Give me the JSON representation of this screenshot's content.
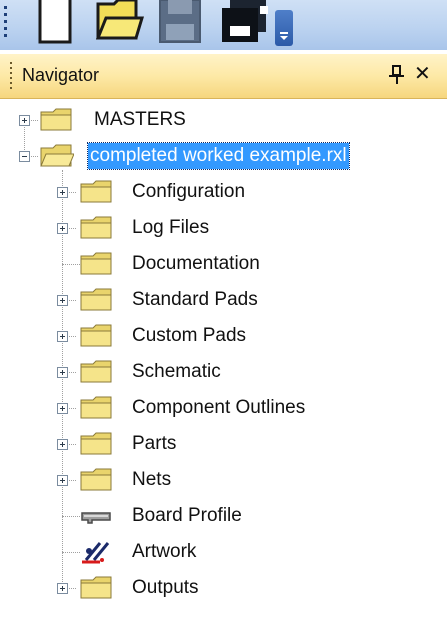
{
  "toolbar": {
    "buttons": [
      {
        "icon": "new-document-icon"
      },
      {
        "icon": "open-folder-icon"
      },
      {
        "icon": "save-disk-icon"
      },
      {
        "icon": "save-all-icon"
      }
    ],
    "overflow_icon": "toolbar-overflow-icon"
  },
  "navigator": {
    "title": "Navigator",
    "pin_icon": "pin-icon",
    "close_glyph": "✕",
    "tree": {
      "masters": "MASTERS",
      "project": "completed worked example.rxl",
      "children": [
        "Configuration",
        "Log Files",
        "Documentation",
        "Standard Pads",
        "Custom Pads",
        "Schematic",
        "Component Outlines",
        "Parts",
        "Nets",
        "Board Profile",
        "Artwork",
        "Outputs"
      ]
    }
  },
  "colors": {
    "selection": "#3399ff",
    "folder": "#f5e48a",
    "header_gradient_top": "#fff3c8",
    "header_gradient_bottom": "#f6d67e",
    "toolbar": "#bcd3f0"
  }
}
